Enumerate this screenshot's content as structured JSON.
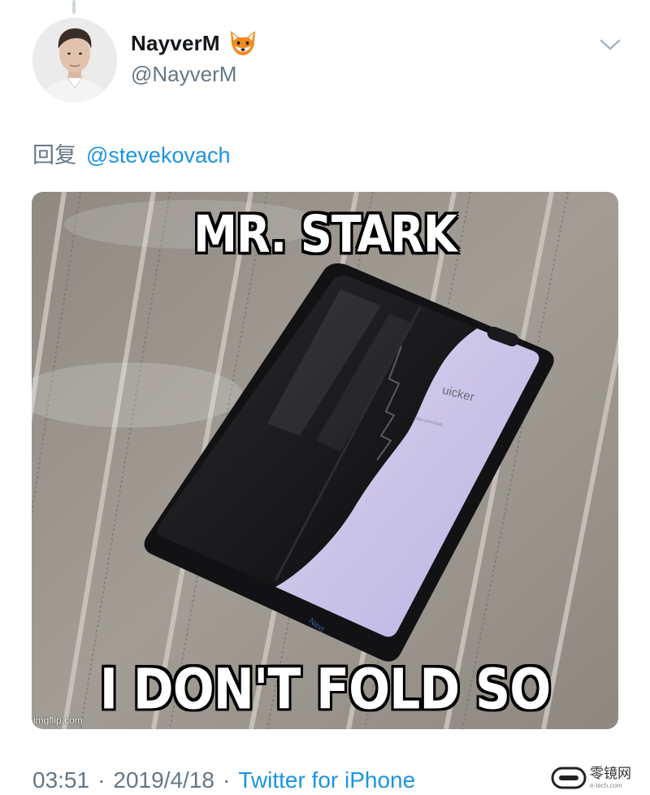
{
  "tweet": {
    "author": {
      "display_name": "NayverM",
      "emoji_icon": "fox-face-icon",
      "handle": "@NayverM"
    },
    "menu_icon": "chevron-down-icon",
    "reply": {
      "label": "回复",
      "mention": "@stevekovach"
    },
    "media": {
      "top_caption": "MR. STARK",
      "bottom_caption": "I DON'T FOLD SO GOOD",
      "watermark": "imgflip.com",
      "screen_text_title": "uicker",
      "screen_text_sub": "your previous",
      "screen_text_next": "Next"
    },
    "footer": {
      "time": "03:51",
      "separator": "·",
      "date": "2019/4/18",
      "source": "Twitter for iPhone"
    }
  },
  "watermark_brand": {
    "name": "零镜网",
    "domain": "e-tech.com"
  },
  "colors": {
    "link": "#1b95e0",
    "secondary_text": "#657786",
    "primary_text": "#14171a"
  }
}
